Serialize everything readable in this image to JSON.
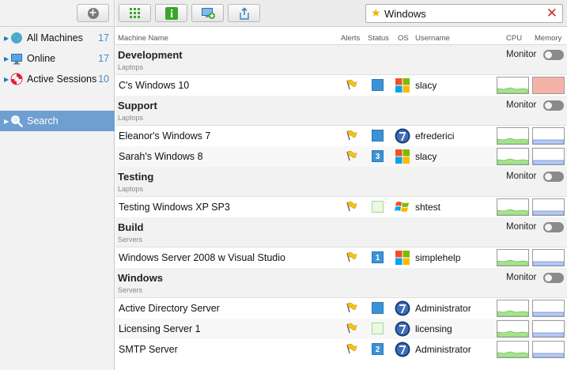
{
  "sidebar": {
    "add_button_icon": "plus-circle-icon",
    "items": [
      {
        "label": "All Machines",
        "count": "17",
        "icon": "globe-icon"
      },
      {
        "label": "Online",
        "count": "17",
        "icon": "monitor-icon"
      },
      {
        "label": "Active Sessions",
        "count": "10",
        "icon": "lifebuoy-icon"
      },
      {
        "label": "Search",
        "count": "",
        "icon": "magnifier-icon",
        "active": true
      }
    ]
  },
  "toolbar": {
    "buttons": [
      {
        "icon": "grid-icon"
      },
      {
        "icon": "info-icon"
      },
      {
        "icon": "add-screen-icon"
      },
      {
        "icon": "share-icon"
      }
    ],
    "search": {
      "value": "Windows",
      "icon": "star-icon",
      "clear_icon": "clear-icon"
    }
  },
  "columns": {
    "name": "Machine Name",
    "alerts": "Alerts",
    "status": "Status",
    "os": "OS",
    "username": "Username",
    "cpu": "CPU",
    "memory": "Memory"
  },
  "monitor_label": "Monitor",
  "groups": [
    {
      "title": "Development",
      "subtitle": "Laptops",
      "rows": [
        {
          "name": "C's Windows 10",
          "status": "on",
          "sessions": "",
          "os": "windows-10",
          "user": "slacy",
          "mem_alert": true
        }
      ]
    },
    {
      "title": "Support",
      "subtitle": "Laptops",
      "rows": [
        {
          "name": "Eleanor's Windows 7",
          "status": "on",
          "sessions": "",
          "os": "windows-7",
          "user": "efrederici",
          "mem_alert": false
        },
        {
          "name": "Sarah's Windows 8",
          "status": "on",
          "sessions": "3",
          "os": "windows-10",
          "user": "slacy",
          "mem_alert": false
        }
      ]
    },
    {
      "title": "Testing",
      "subtitle": "Laptops",
      "rows": [
        {
          "name": "Testing Windows XP SP3",
          "status": "off",
          "sessions": "",
          "os": "windows-xp",
          "user": "shtest",
          "mem_alert": false
        }
      ]
    },
    {
      "title": "Build",
      "subtitle": "Servers",
      "rows": [
        {
          "name": "Windows Server 2008 w Visual Studio",
          "status": "on",
          "sessions": "1",
          "os": "windows-10",
          "user": "simplehelp",
          "mem_alert": false
        }
      ]
    },
    {
      "title": "Windows",
      "subtitle": "Servers",
      "rows": [
        {
          "name": "Active Directory Server",
          "status": "on",
          "sessions": "",
          "os": "windows-7",
          "user": "Administrator",
          "mem_alert": false
        },
        {
          "name": "Licensing Server 1",
          "status": "off",
          "sessions": "",
          "os": "windows-7",
          "user": "licensing",
          "mem_alert": false
        },
        {
          "name": "SMTP Server",
          "status": "on",
          "sessions": "2",
          "os": "windows-7",
          "user": "Administrator",
          "mem_alert": false
        }
      ]
    }
  ],
  "colors": {
    "accent": "#6e9fd0",
    "status_on": "#3a93d6",
    "status_off": "#eaf8e4",
    "memory_alert": "#f5b3a8",
    "cpu_graph": "#8fd87a",
    "mem_graph": "#7f9de8"
  }
}
